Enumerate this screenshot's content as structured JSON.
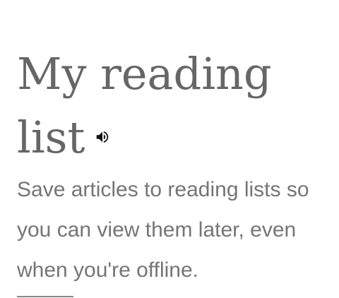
{
  "onboarding": {
    "title": "My reading list",
    "speaker_icon": "volume-up-icon",
    "description": "Save articles to reading lists so you can view them later, even when you're offline."
  },
  "colors": {
    "title": "#666666",
    "description": "#757575",
    "divider": "#888888",
    "icon": "#111111"
  }
}
